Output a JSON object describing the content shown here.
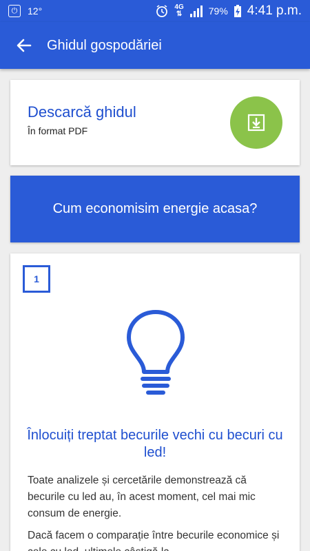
{
  "status": {
    "temperature": "12°",
    "network": "4G",
    "battery": "79%",
    "time": "4:41 p.m."
  },
  "app_bar": {
    "title": "Ghidul gospodăriei"
  },
  "download_card": {
    "title": "Descarcă ghidul",
    "subtitle": "În format PDF"
  },
  "banner": {
    "text": "Cum economisim energie acasa?"
  },
  "tip": {
    "number": "1",
    "title": "Înlocuiți treptat becurile vechi cu becuri cu led!",
    "paragraphs": [
      "Toate analizele și cercetările demonstrează că becurile cu led au, în acest moment, cel mai mic consum de energie.",
      "Dacă facem o comparație între becurile economice și cele cu led, ultimele câștigă la"
    ]
  },
  "colors": {
    "primary": "#2a5bd7",
    "accent_green": "#8bc34a"
  },
  "icons": [
    "power-icon",
    "alarm-icon",
    "signal-icon",
    "battery-charging-icon",
    "back-arrow-icon",
    "download-icon",
    "lightbulb-icon"
  ]
}
